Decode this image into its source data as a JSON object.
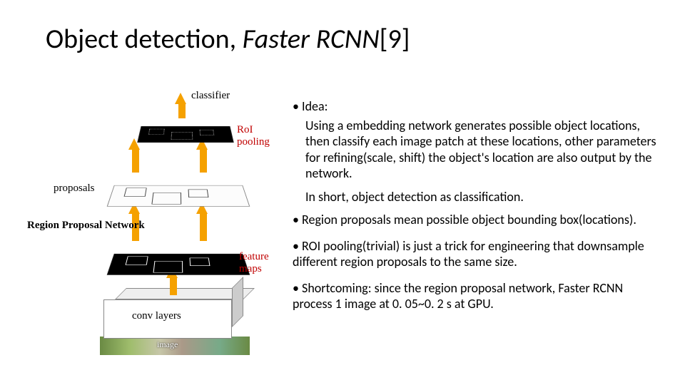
{
  "title": {
    "prefix": "Object detection, ",
    "italic": "Faster RCNN",
    "suffix": "[9]"
  },
  "bullets": {
    "idea_label": "Idea:",
    "idea_body": "Using a embedding network generates possible object locations, then classify each image patch at these locations, other parameters for refining(scale, shift) the object's location are also output by the network.",
    "idea_short": "In short, object detection as classification.",
    "b2": "Region proposals mean possible object bounding box(locations).",
    "b3": "ROI pooling(trivial) is just a trick for engineering that downsample different region proposals to the same size.",
    "b4": "Shortcoming: since the region proposal network, Faster RCNN process 1 image at 0. 05~0. 2 s at GPU."
  },
  "diagram": {
    "classifier": "classifier",
    "roi_pooling": "RoI pooling",
    "proposals": "proposals",
    "rpn": "Region Proposal Network",
    "feature_maps": "feature maps",
    "conv_layers": "conv layers",
    "image": "image"
  }
}
